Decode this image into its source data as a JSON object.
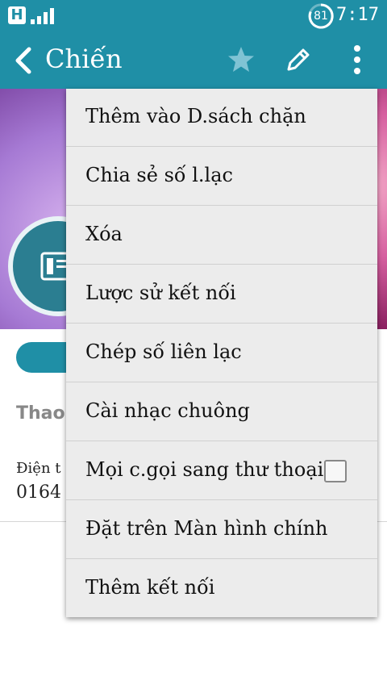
{
  "status_bar": {
    "carrier_badge": "H",
    "battery_level": "81",
    "time": "7:17"
  },
  "app_bar": {
    "title": "Chiến",
    "icons": [
      "back-arrow-icon",
      "star-icon",
      "edit-pencil-icon",
      "more-vertical-icon"
    ]
  },
  "contact": {
    "section_label": "Thao",
    "phone_label": "Điện t",
    "phone_number": "0164"
  },
  "menu": {
    "items": [
      {
        "label": "Thêm vào D.sách chặn"
      },
      {
        "label": "Chia sẻ số l.lạc"
      },
      {
        "label": "Xóa"
      },
      {
        "label": "Lược sử kết nối"
      },
      {
        "label": "Chép số liên lạc"
      },
      {
        "label": "Cài nhạc chuông"
      },
      {
        "label": "Mọi c.gọi sang thư thoại",
        "checked": false
      },
      {
        "label": "Đặt trên Màn hình chính"
      },
      {
        "label": "Thêm kết nối"
      }
    ]
  },
  "colors": {
    "accent": "#1f8fa6",
    "menu_bg": "#ececec"
  }
}
